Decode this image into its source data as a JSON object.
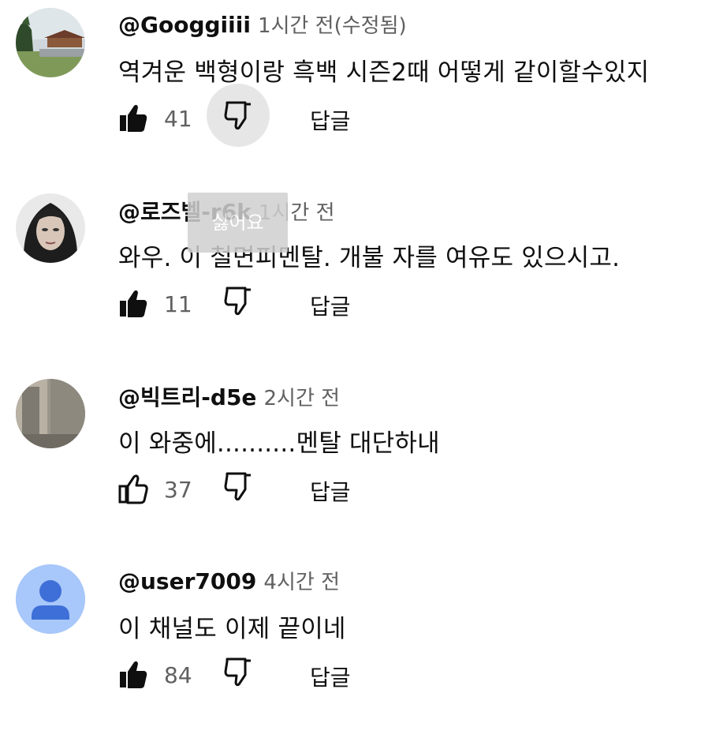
{
  "tooltip": "싫어요",
  "comments": [
    {
      "handle": "@Googgiiii",
      "time": "1시간 전(수정됨)",
      "text": "역겨운 백형이랑 흑백 시즌2때 어떻게  같이할수있지",
      "likes": "41",
      "liked": true,
      "reply": "답글",
      "avatar": "landscape-photo"
    },
    {
      "handle": "@로즈벨-r6k",
      "time": "1시간 전",
      "text": "와우. 이 철면피멘탈. 개불 자를 여유도 있으시고.",
      "likes": "11",
      "liked": true,
      "reply": "답글",
      "avatar": "portrait-photo"
    },
    {
      "handle": "@빅트리-d5e",
      "time": "2시간 전",
      "text": "이 와중에..........멘탈 대단하내",
      "likes": "37",
      "liked": false,
      "reply": "답글",
      "avatar": "room-photo"
    },
    {
      "handle": "@user7009",
      "time": "4시간 전",
      "text": "이 채널도 이제 끝이네",
      "likes": "84",
      "liked": true,
      "reply": "답글",
      "avatar": "default-user-avatar"
    }
  ],
  "colors": {
    "text": "#0f0f0f",
    "secondary": "#606060",
    "pressed_bg": "#e6e6e6",
    "default_avatar_bg": "#a8c7fa",
    "default_avatar_fg": "#3e6fd8"
  }
}
